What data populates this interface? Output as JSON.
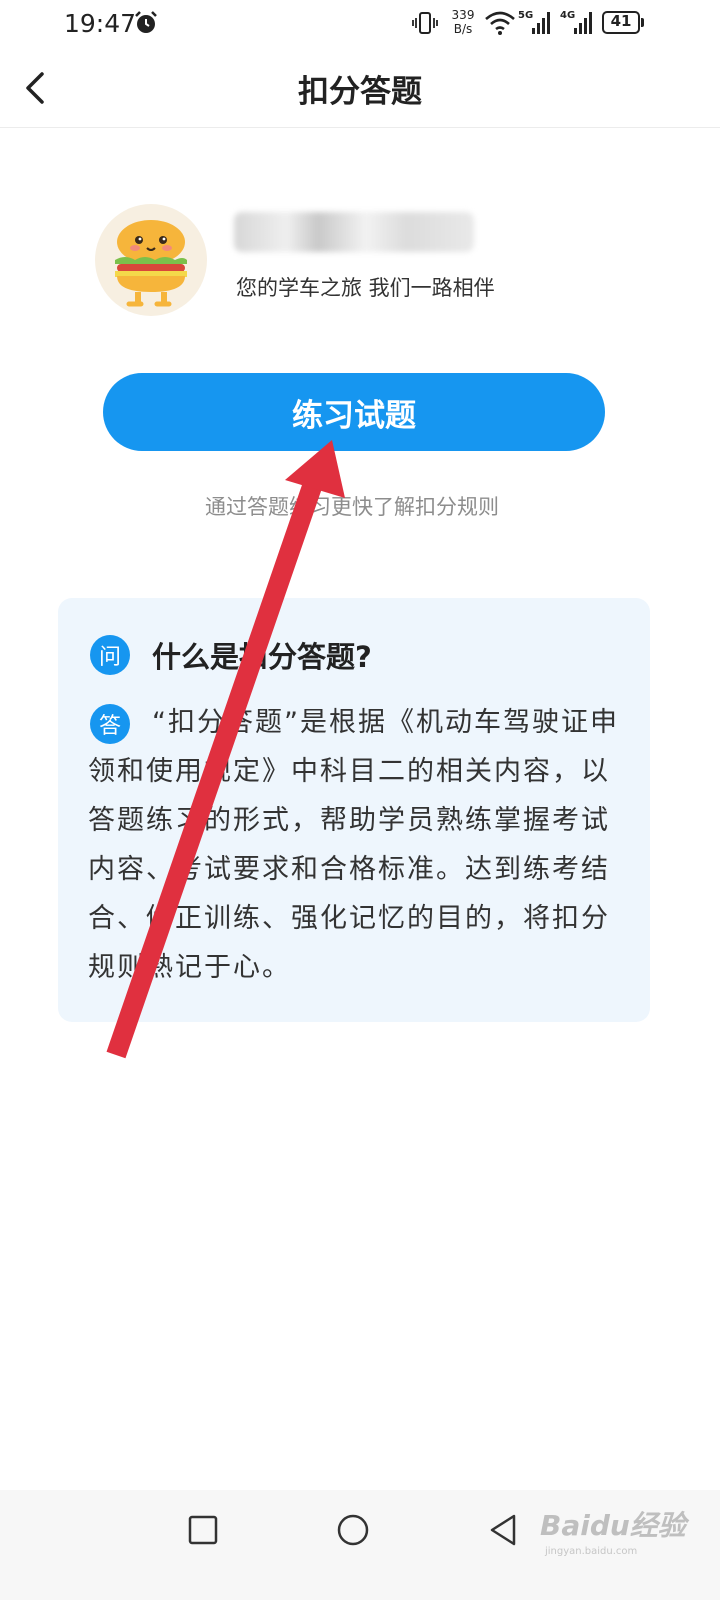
{
  "status_bar": {
    "time": "19:47",
    "net_speed_value": "339",
    "net_speed_unit": "B/s",
    "signal1_label": "5G",
    "signal2_label": "4G",
    "battery": "41"
  },
  "nav": {
    "title": "扣分答题",
    "back_icon": "chevron-left-icon"
  },
  "profile": {
    "subtitle": "您的学车之旅 我们一路相伴"
  },
  "practice": {
    "button_label": "练习试题",
    "hint": "通过答题练习更快了解扣分规则"
  },
  "faq": {
    "q_badge": "问",
    "question": "什么是扣分答题?",
    "a_badge": "答",
    "answer": "“扣分答题”是根据《机动车驾驶证申领和使用规定》中科目二的相关内容，以答题练习的形式，帮助学员熟练掌握考试内容、考试要求和合格标准。达到练考结合、修正训练、强化记忆的目的，将扣分规则熟记于心。"
  },
  "watermark": {
    "brand": "Baidu经验",
    "url": "jingyan.baidu.com"
  },
  "colors": {
    "accent": "#1696f0",
    "card_bg": "#eef6fd",
    "arrow": "#e0303f"
  }
}
